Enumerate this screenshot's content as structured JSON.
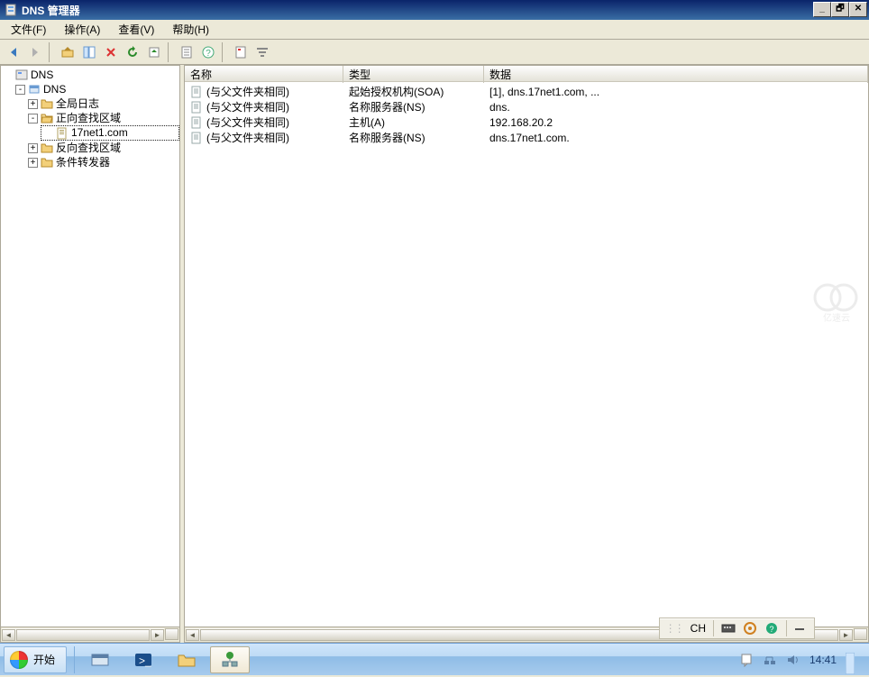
{
  "window": {
    "title": "DNS 管理器"
  },
  "menu": {
    "file": "文件(F)",
    "action": "操作(A)",
    "view": "查看(V)",
    "help": "帮助(H)"
  },
  "tree": {
    "root": "DNS",
    "server": "DNS",
    "global_logs": "全局日志",
    "forward_zone": "正向查找区域",
    "zone_name": "17net1.com",
    "reverse_zone": "反向查找区域",
    "cond_fwd": "条件转发器"
  },
  "columns": {
    "name": "名称",
    "type": "类型",
    "data": "数据"
  },
  "records": [
    {
      "name": "(与父文件夹相同)",
      "type": "起始授权机构(SOA)",
      "data": "[1], dns.17net1.com, ..."
    },
    {
      "name": "(与父文件夹相同)",
      "type": "名称服务器(NS)",
      "data": "dns."
    },
    {
      "name": "(与父文件夹相同)",
      "type": "主机(A)",
      "data": "192.168.20.2"
    },
    {
      "name": "(与父文件夹相同)",
      "type": "名称服务器(NS)",
      "data": "dns.17net1.com."
    }
  ],
  "langbar": {
    "lang": "CH"
  },
  "taskbar": {
    "start": "开始",
    "clock": "14:41"
  },
  "watermark": "亿速云"
}
